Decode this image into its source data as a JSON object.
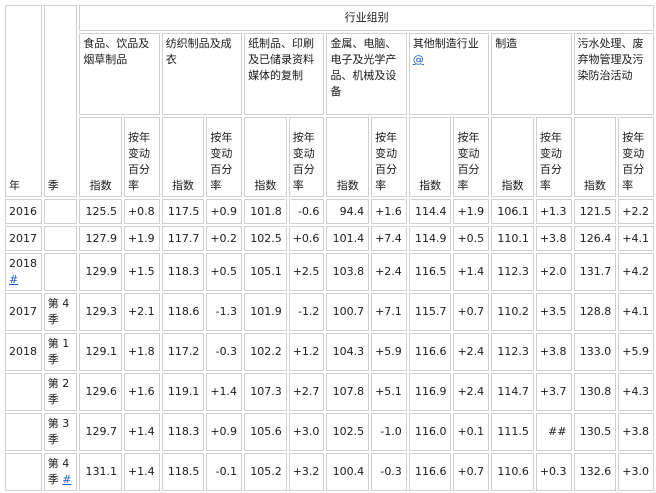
{
  "header": {
    "year": "年",
    "quarter": "季",
    "group_title": "行业组别",
    "groups": [
      {
        "name": "食品、饮品及烟草制品",
        "link": ""
      },
      {
        "name": "纺织制品及成衣",
        "link": ""
      },
      {
        "name": "纸制品、印刷及已储录资料媒体的复制",
        "link": ""
      },
      {
        "name": "金属、电脑、电子及光学产品、机械及设备",
        "link": ""
      },
      {
        "name": "其他制造行业",
        "link": "@"
      },
      {
        "name": "制造",
        "link": ""
      },
      {
        "name": "污水处理、废弃物管理及污染防治活动",
        "link": ""
      }
    ],
    "index_label": "指数",
    "change_label": "按年变动百分率"
  },
  "rows": [
    {
      "year": "2016",
      "quarter": "",
      "mark": "",
      "cells": [
        "125.5",
        "+0.8",
        "117.5",
        "+0.9",
        "101.8",
        "-0.6",
        "94.4",
        "+1.6",
        "114.4",
        "+1.9",
        "106.1",
        "+1.3",
        "121.5",
        "+2.2"
      ]
    },
    {
      "year": "2017",
      "quarter": "",
      "mark": "",
      "cells": [
        "127.9",
        "+1.9",
        "117.7",
        "+0.2",
        "102.5",
        "+0.6",
        "101.4",
        "+7.4",
        "114.9",
        "+0.5",
        "110.1",
        "+3.8",
        "126.4",
        "+4.1"
      ]
    },
    {
      "year": "2018",
      "quarter": "",
      "mark": "#",
      "cells": [
        "129.9",
        "+1.5",
        "118.3",
        "+0.5",
        "105.1",
        "+2.5",
        "103.8",
        "+2.4",
        "116.5",
        "+1.4",
        "112.3",
        "+2.0",
        "131.7",
        "+4.2"
      ]
    },
    {
      "year": "2017",
      "quarter": "第 4 季",
      "mark": "",
      "cells": [
        "129.3",
        "+2.1",
        "118.6",
        "-1.3",
        "101.9",
        "-1.2",
        "100.7",
        "+7.1",
        "115.7",
        "+0.7",
        "110.2",
        "+3.5",
        "128.8",
        "+4.1"
      ]
    },
    {
      "year": "2018",
      "quarter": "第 1 季",
      "mark": "",
      "cells": [
        "129.1",
        "+1.8",
        "117.2",
        "-0.3",
        "102.2",
        "+1.2",
        "104.3",
        "+5.9",
        "116.6",
        "+2.4",
        "112.3",
        "+3.8",
        "133.0",
        "+5.9"
      ]
    },
    {
      "year": "",
      "quarter": "第 2 季",
      "mark": "",
      "cells": [
        "129.6",
        "+1.6",
        "119.1",
        "+1.4",
        "107.3",
        "+2.7",
        "107.8",
        "+5.1",
        "116.9",
        "+2.4",
        "114.7",
        "+3.7",
        "130.8",
        "+4.3"
      ]
    },
    {
      "year": "",
      "quarter": "第 3 季",
      "mark": "",
      "cells": [
        "129.7",
        "+1.4",
        "118.3",
        "+0.9",
        "105.6",
        "+3.0",
        "102.5",
        "-1.0",
        "116.0",
        "+0.1",
        "111.5",
        "##",
        "130.5",
        "+3.8"
      ]
    },
    {
      "year": "",
      "quarter": "第 4 季",
      "mark": "#",
      "cells": [
        "131.1",
        "+1.4",
        "118.5",
        "-0.1",
        "105.2",
        "+3.2",
        "100.4",
        "-0.3",
        "116.6",
        "+0.7",
        "110.6",
        "+0.3",
        "132.6",
        "+3.0"
      ]
    }
  ]
}
